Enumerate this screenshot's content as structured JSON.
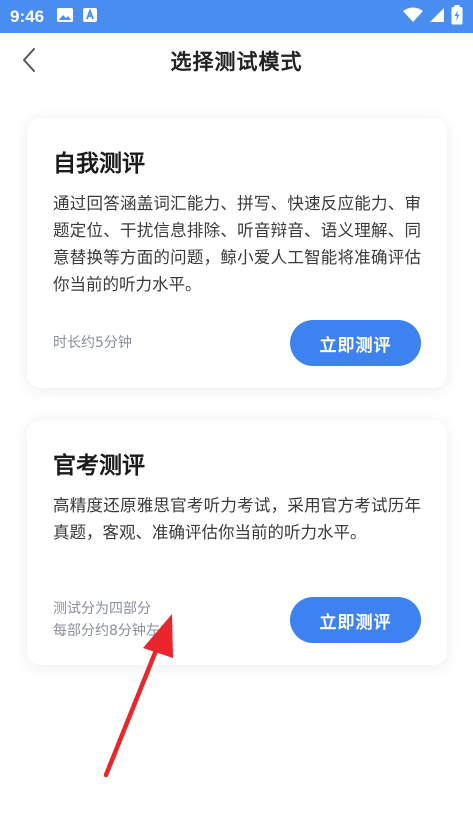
{
  "status_bar": {
    "time": "9:46",
    "icons": [
      "image-icon",
      "a-letter-icon",
      "wifi-icon",
      "signal-icon",
      "battery-charging-icon"
    ],
    "color": "#4a8df0"
  },
  "header": {
    "title": "选择测试模式",
    "back_icon": "chevron-left-icon"
  },
  "cards": [
    {
      "title": "自我测评",
      "description": "通过回答涵盖词汇能力、拼写、快速反应能力、审题定位、干扰信息排除、听音辩音、语义理解、同意替换等方面的问题，鲸小爱人工智能将准确评估你当前的听力水平。",
      "meta_lines": [
        "时长约5分钟"
      ],
      "button_label": "立即测评"
    },
    {
      "title": "官考测评",
      "description": "高精度还原雅思官考听力考试，采用官方考试历年真题，客观、准确评估你当前的听力水平。",
      "meta_lines": [
        "测试分为四部分",
        "每部分约8分钟左右"
      ],
      "button_label": "立即测评"
    }
  ],
  "colors": {
    "accent": "#3d82f0",
    "annotation_arrow": "#e8262c"
  }
}
